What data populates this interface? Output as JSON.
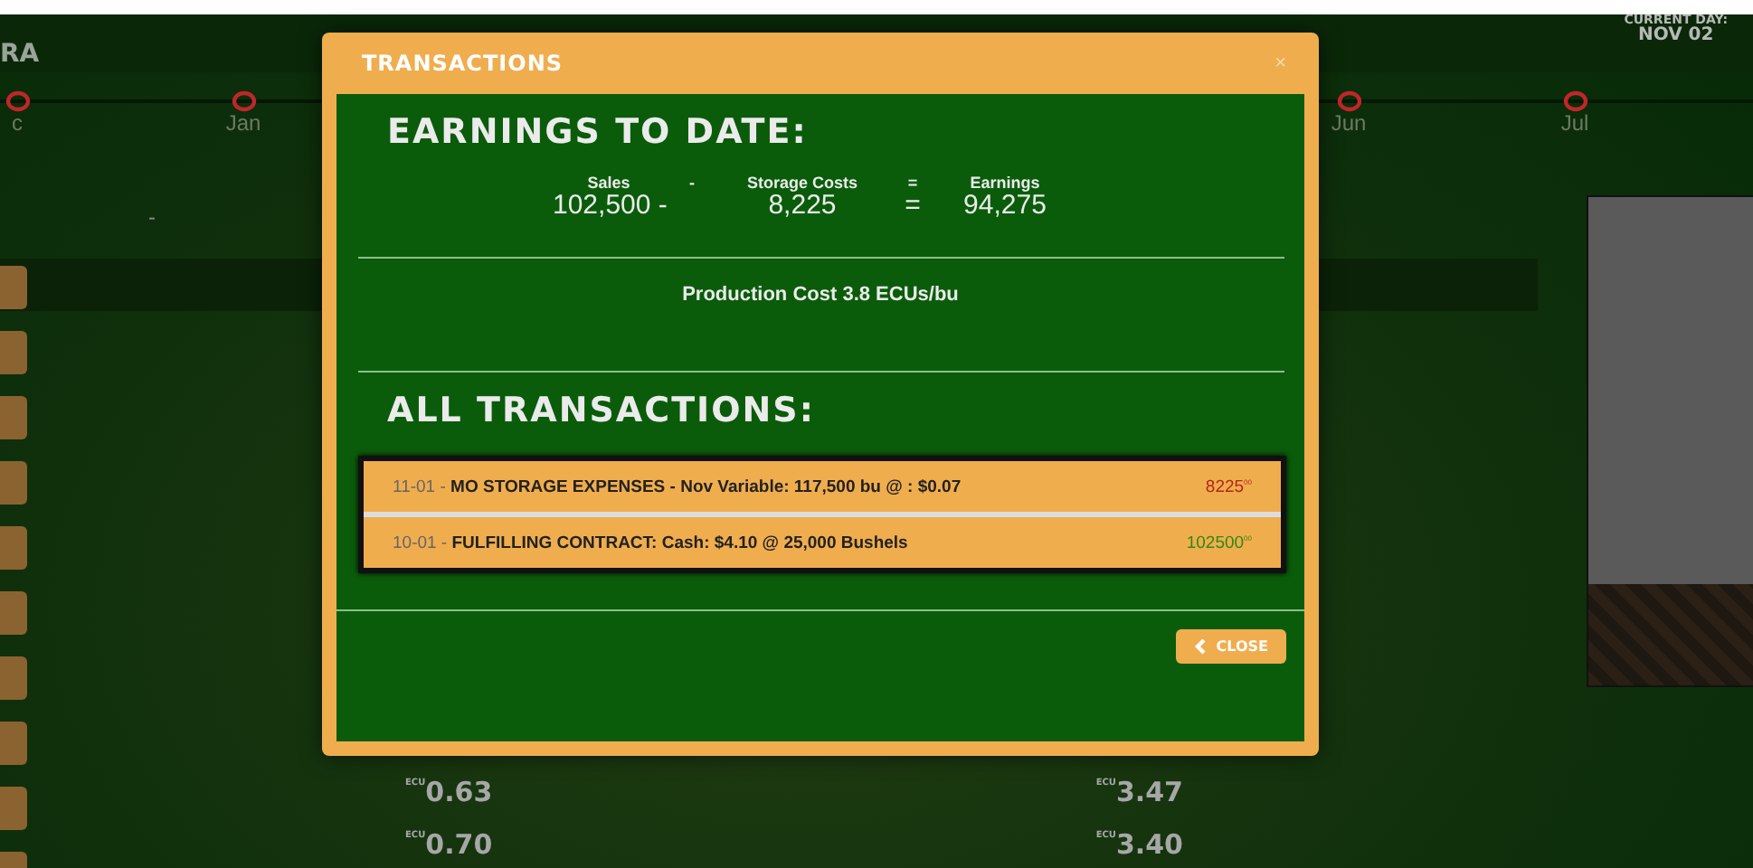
{
  "header": {
    "title": "RA",
    "current_day_label": "CURRENT DAY:",
    "current_day": "NOV 02"
  },
  "timeline": [
    {
      "label": "c"
    },
    {
      "label": "Jan"
    },
    {
      "label": "Jun"
    },
    {
      "label": "Jul"
    }
  ],
  "background": {
    "dash": "-",
    "prices_left": [
      "$^{ECU}$0.63",
      "$^{ECU}$0.70"
    ],
    "prices_right": [
      "$^{ECU}$3.47",
      "$^{ECU}$3.40"
    ]
  },
  "modal": {
    "title": "TRANSACTIONS",
    "close_glyph": "×",
    "earnings_heading": "EARNINGS TO DATE:",
    "formula": {
      "headers": [
        "Sales",
        "-",
        "Storage Costs",
        "=",
        "Earnings"
      ],
      "values": [
        "102,500 -",
        "8,225",
        "=",
        "94,275"
      ]
    },
    "production_cost": "Production Cost 3.8 ECUs/bu",
    "transactions_heading": "ALL TRANSACTIONS:",
    "transactions": [
      {
        "date": "11-01 -",
        "text": "MO STORAGE EXPENSES - Nov Variable: 117,500 bu @ : $0.07",
        "amount": "8225$^{00}$",
        "color": "#b0271a"
      },
      {
        "date": "10-01 -",
        "text": "FULFILLING CONTRACT: Cash: $4.10 @ 25,000 Bushels",
        "amount": "102500$^{00}$",
        "color": "#2e8a12"
      }
    ],
    "close_button": "CLOSE"
  }
}
